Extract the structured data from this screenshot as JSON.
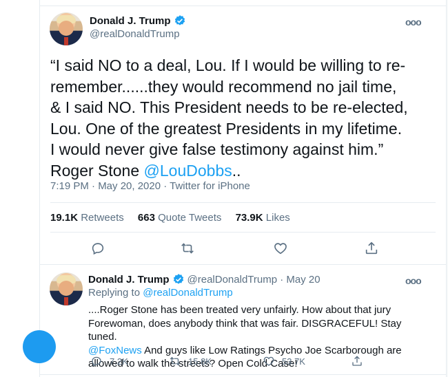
{
  "main_tweet": {
    "display_name": "Donald J. Trump",
    "handle": "@realDonaldTrump",
    "text": "“I said NO to a deal, Lou. If I would be willing to re-remember......they would recommend no jail time, & I said NO. This President needs to be re-elected, Lou. One of the greatest Presidents in my lifetime. I would never give false testimony against him.” Roger Stone ",
    "mention": "@LouDobbs",
    "text_end": "..",
    "timestamp": "7:19 PM · May 20, 2020 · Twitter for iPhone",
    "retweets_count": "19.1K",
    "retweets_label": "Retweets",
    "quotes_count": "663",
    "quotes_label": "Quote Tweets",
    "likes_count": "73.9K",
    "likes_label": "Likes"
  },
  "reply_tweet": {
    "display_name": "Donald J. Trump",
    "handle_time": "@realDonaldTrump · May 20",
    "replying_label": "Replying to ",
    "replying_handle": "@realDonaldTrump",
    "text_part1": "....Roger Stone has been treated very unfairly. How about that jury Forewoman, does anybody think that was fair. DISGRACEFUL! Stay tuned.",
    "mention": "@FoxNews",
    "text_part2": " And guys like Low Ratings Psycho Joe Scarborough are allowed to walk the streets? Open Cold Case!",
    "replies": "7.2K",
    "retweets": "15.8K",
    "likes": "53.7K"
  },
  "colors": {
    "accent": "#1da1f2",
    "secondary_text": "#5b7083",
    "border": "#e6ecf0"
  },
  "icons": [
    "verified-badge-icon",
    "more-icon",
    "reply-icon",
    "retweet-icon",
    "like-icon",
    "share-icon"
  ]
}
